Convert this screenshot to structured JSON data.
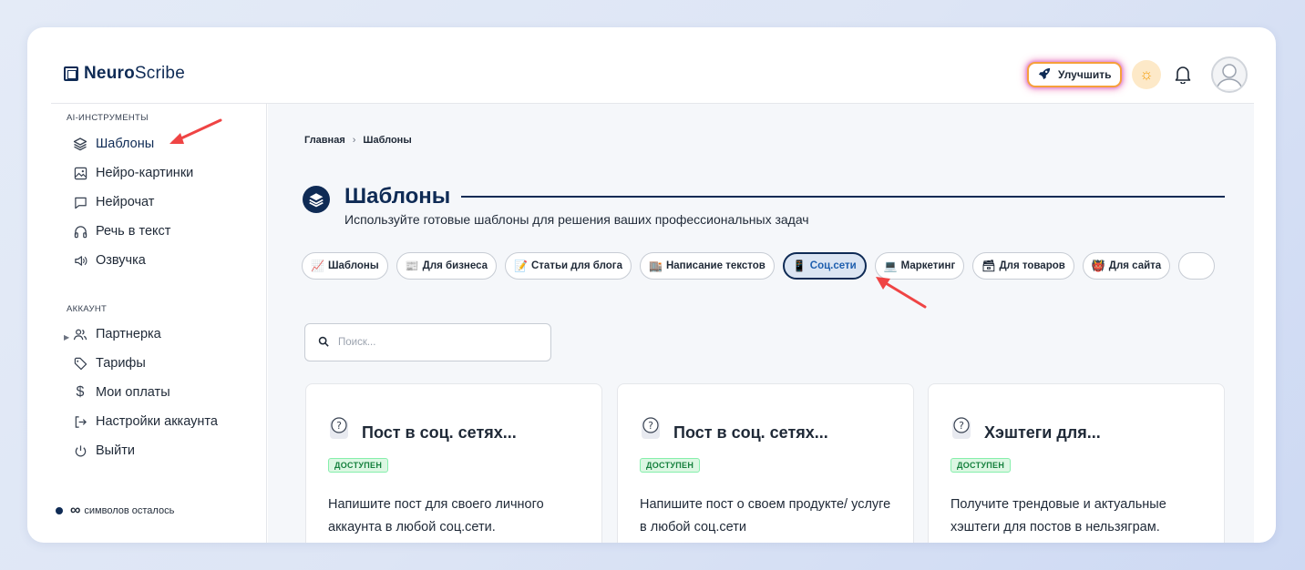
{
  "app": {
    "logo_bold": "Neuro",
    "logo_rest": "Scribe",
    "upgrade_label": "Улучшить"
  },
  "sidebar": {
    "section_tools": "AI-ИНСТРУМЕНТЫ",
    "tools": [
      {
        "label": "Шаблоны",
        "icon": "layers-icon"
      },
      {
        "label": "Нейро-картинки",
        "icon": "image-icon"
      },
      {
        "label": "Нейрочат",
        "icon": "chat-icon"
      },
      {
        "label": "Речь в текст",
        "icon": "headphones-icon"
      },
      {
        "label": "Озвучка",
        "icon": "speaker-icon"
      }
    ],
    "section_account": "АККАУНТ",
    "account": [
      {
        "label": "Партнерка",
        "icon": "users-icon"
      },
      {
        "label": "Тарифы",
        "icon": "tag-icon"
      },
      {
        "label": "Мои оплаты",
        "icon": "dollar-icon"
      },
      {
        "label": "Настройки аккаунта",
        "icon": "logout-arrow-icon"
      },
      {
        "label": "Выйти",
        "icon": "power-icon"
      }
    ],
    "credits_symbol": "∞",
    "credits_text": "символов осталось"
  },
  "breadcrumb": {
    "home": "Главная",
    "current": "Шаблоны"
  },
  "page": {
    "title": "Шаблоны",
    "subtitle": "Используйте готовые шаблоны для решения ваших профессиональных задач"
  },
  "chips": [
    {
      "emoji": "📈",
      "label": "Шаблоны"
    },
    {
      "emoji": "📰",
      "label": "Для бизнеса"
    },
    {
      "emoji": "📝",
      "label": "Статьи для блога"
    },
    {
      "emoji": "🏬",
      "label": "Написание текстов"
    },
    {
      "emoji": "📱",
      "label": "Соц.сети",
      "active": true
    },
    {
      "emoji": "💻",
      "label": "Маркетинг"
    },
    {
      "emoji": "🗃",
      "label": "Для товаров"
    },
    {
      "emoji": "👹",
      "label": "Для сайта"
    }
  ],
  "search": {
    "placeholder": "Поиск..."
  },
  "cards": [
    {
      "title": "Пост в соц. сетях...",
      "badge": "ДОСТУПЕН",
      "desc": "Напишите пост для своего личного аккаунта в любой соц.сети."
    },
    {
      "title": "Пост в соц. сетях...",
      "badge": "ДОСТУПЕН",
      "desc": "Напишите пост о своем продукте/ услуге в любой соц.сети"
    },
    {
      "title": "Хэштеги для...",
      "badge": "ДОСТУПЕН",
      "desc": "Получите трендовые и актуальные хэштеги для постов в нельзяграм."
    }
  ],
  "colors": {
    "brand": "#0f2b55",
    "accent_arrow": "#ef4444",
    "badge_green": "#15803d"
  }
}
